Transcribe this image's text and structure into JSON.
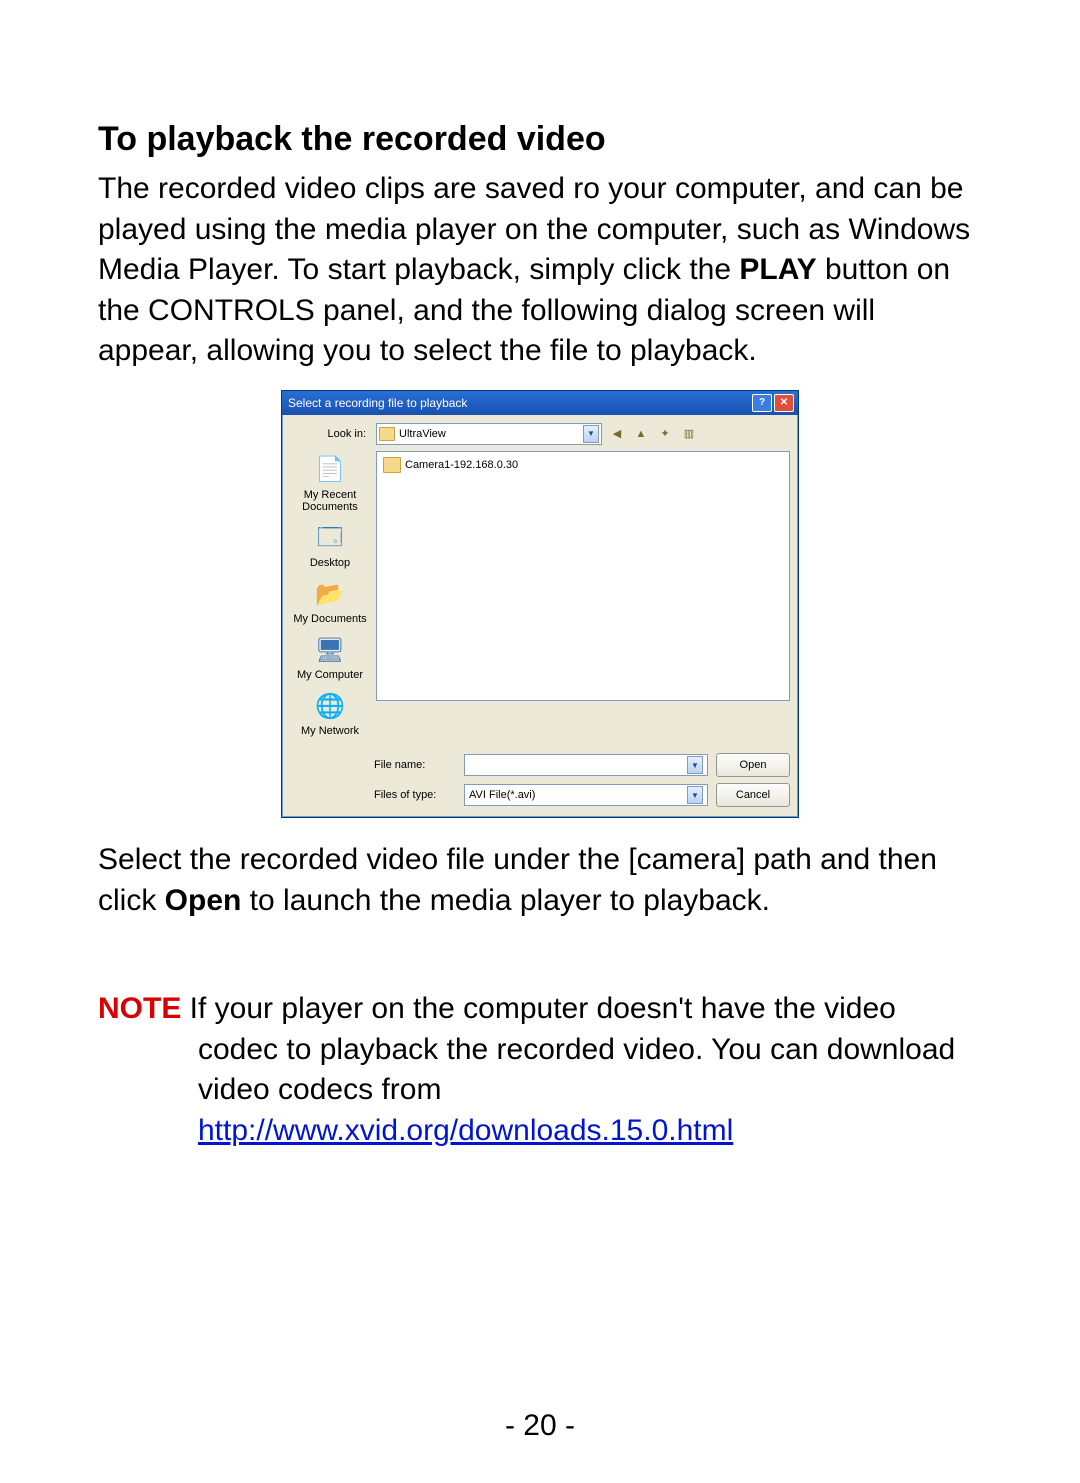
{
  "heading": "To playback the recorded video",
  "intro_pre": "The recorded video clips are saved ro your computer, and can be played using the media player on the computer, such as Windows Media Player.  To start playback, simply click the ",
  "intro_bold": "PLAY",
  "intro_post": " button on the CONTROLS panel, and the following dialog screen will appear, allowing you to select the file to playback.",
  "outro_pre": "Select the recorded video file under the [camera] path and then click ",
  "outro_bold": "Open",
  "outro_post": " to launch the media player to playback.",
  "note_label": "NOTE",
  "note_line1": " If your player on the computer doesn't have the video",
  "note_line2": "codec to playback the recorded video. You can download video codecs from",
  "note_link": "http://www.xvid.org/downloads.15.0.html",
  "page_number": "- 20 -",
  "dialog": {
    "title": "Select a recording file to playback",
    "help_symbol": "?",
    "close_symbol": "✕",
    "lookin_label": "Look in:",
    "lookin_value": "UltraView",
    "toolbar_icons": {
      "back": "◀",
      "up": "▲",
      "newfolder": "✦",
      "views": "▥"
    },
    "places": {
      "recent": "My Recent Documents",
      "desktop": "Desktop",
      "mydocs": "My Documents",
      "mycomp": "My Computer",
      "mynet": "My Network"
    },
    "file_item": "Camera1-192.168.0.30",
    "filename_label": "File name:",
    "filename_value": "",
    "filetype_label": "Files of type:",
    "filetype_value": "AVI File(*.avi)",
    "open_btn": "Open",
    "cancel_btn": "Cancel"
  }
}
